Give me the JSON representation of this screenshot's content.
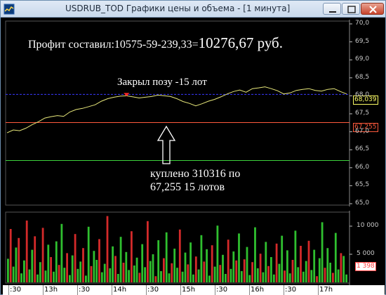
{
  "window": {
    "title": "USDRUB_TOD Графики цены и объема - [1 минута]",
    "icon": "chart-app-icon"
  },
  "annotations": {
    "profit_prefix": "Профит составил:10575-59-239,33=",
    "profit_value": "10276,67 руб.",
    "closed_position": "Закрыл позу -15 лот",
    "bought_line1": "куплено 310316 по",
    "bought_line2": "67,255   15 лотов"
  },
  "price_tags": {
    "current": "68,039",
    "buy": "67,255",
    "volume": "1 398"
  },
  "colors": {
    "background": "#000000",
    "price_line": "#e8e87a",
    "current_level": "#3a3aff",
    "buy_level": "#ff5a3c",
    "lower_level": "#3cd23c",
    "volume_up": "#2fbf2f",
    "volume_down": "#d42a2a"
  },
  "chart_data": [
    {
      "type": "line",
      "ylim": [
        65.0,
        70.0
      ],
      "y_ticks": [
        "70,0",
        "69,5",
        "69,0",
        "68,5",
        "68,0",
        "67,5",
        "67,0",
        "66,5",
        "66,0",
        "65,5",
        "65,0"
      ],
      "series": [
        {
          "values": [
            66.97,
            67.05,
            67.03,
            67.1,
            67.2,
            67.28,
            67.38,
            67.42,
            67.45,
            67.43,
            67.55,
            67.62,
            67.65,
            67.7,
            67.75,
            67.85,
            67.92,
            67.96,
            67.99,
            68.0,
            67.97,
            67.94,
            67.96,
            67.98,
            68.02,
            68.0,
            67.98,
            67.92,
            67.84,
            67.79,
            67.72,
            67.78,
            67.85,
            67.9,
            67.97,
            68.05,
            68.12,
            68.16,
            68.1,
            68.2,
            68.22,
            68.25,
            68.2,
            68.14,
            68.05,
            68.08,
            68.15,
            68.18,
            68.2,
            68.15,
            68.13,
            68.18,
            68.2,
            68.12,
            68.05
          ]
        }
      ],
      "levels": [
        {
          "name": "current",
          "value": 68.039,
          "label": "68,039"
        },
        {
          "name": "buy",
          "value": 67.255,
          "label": "67,255"
        },
        {
          "name": "lower",
          "value": 66.2
        }
      ],
      "markers": [
        {
          "type": "sell",
          "value": 67.98
        }
      ]
    },
    {
      "type": "bar",
      "ylim": [
        0,
        12000
      ],
      "y_ticks": [
        "10 000",
        "5 000"
      ],
      "x_ticks": [
        ":30",
        "13h",
        ":30",
        "14h",
        ":30",
        "15h",
        ":30",
        "16h",
        ":30",
        "17h"
      ],
      "values": [
        4200,
        9500,
        2800,
        6200,
        7900,
        1600,
        3900,
        11000,
        2300,
        5800,
        8200,
        1400,
        3600,
        9700,
        2100,
        6700,
        4500,
        1900,
        7300,
        3100,
        10400,
        2600,
        5200,
        1300,
        4800,
        8600,
        2400,
        3700,
        6100,
        1200,
        9900,
        2900,
        5600,
        4000,
        7700,
        1800,
        3300,
        11800,
        2500,
        6400,
        4700,
        1500,
        8100,
        3500,
        5400,
        2200,
        9100,
        3000,
        4400,
        1700,
        6800,
        2700,
        10900,
        3800,
        5000,
        1100,
        7500,
        2000,
        4300,
        8900,
        1600,
        3400,
        6000,
        2600,
        9400,
        1900,
        5300,
        3200,
        7100,
        1400,
        4600,
        2300,
        8400,
        3700,
        5900,
        1200,
        6600,
        2800,
        10100,
        3100,
        4900,
        1500,
        7600,
        2400,
        5500,
        3900,
        8700,
        2000,
        4100,
        6300,
        1300,
        3600,
        9800,
        2500,
        5100,
        1800,
        7200,
        2900,
        4500,
        1400,
        6900,
        3300,
        8300,
        2100,
        5700,
        1600,
        4000,
        9200,
        2700,
        6500,
        1900,
        3800,
        7400,
        2200,
        5800,
        1100,
        4300,
        10700,
        2600,
        6100,
        3500,
        1700,
        8800,
        2300,
        5200,
        4700,
        1398
      ]
    }
  ]
}
